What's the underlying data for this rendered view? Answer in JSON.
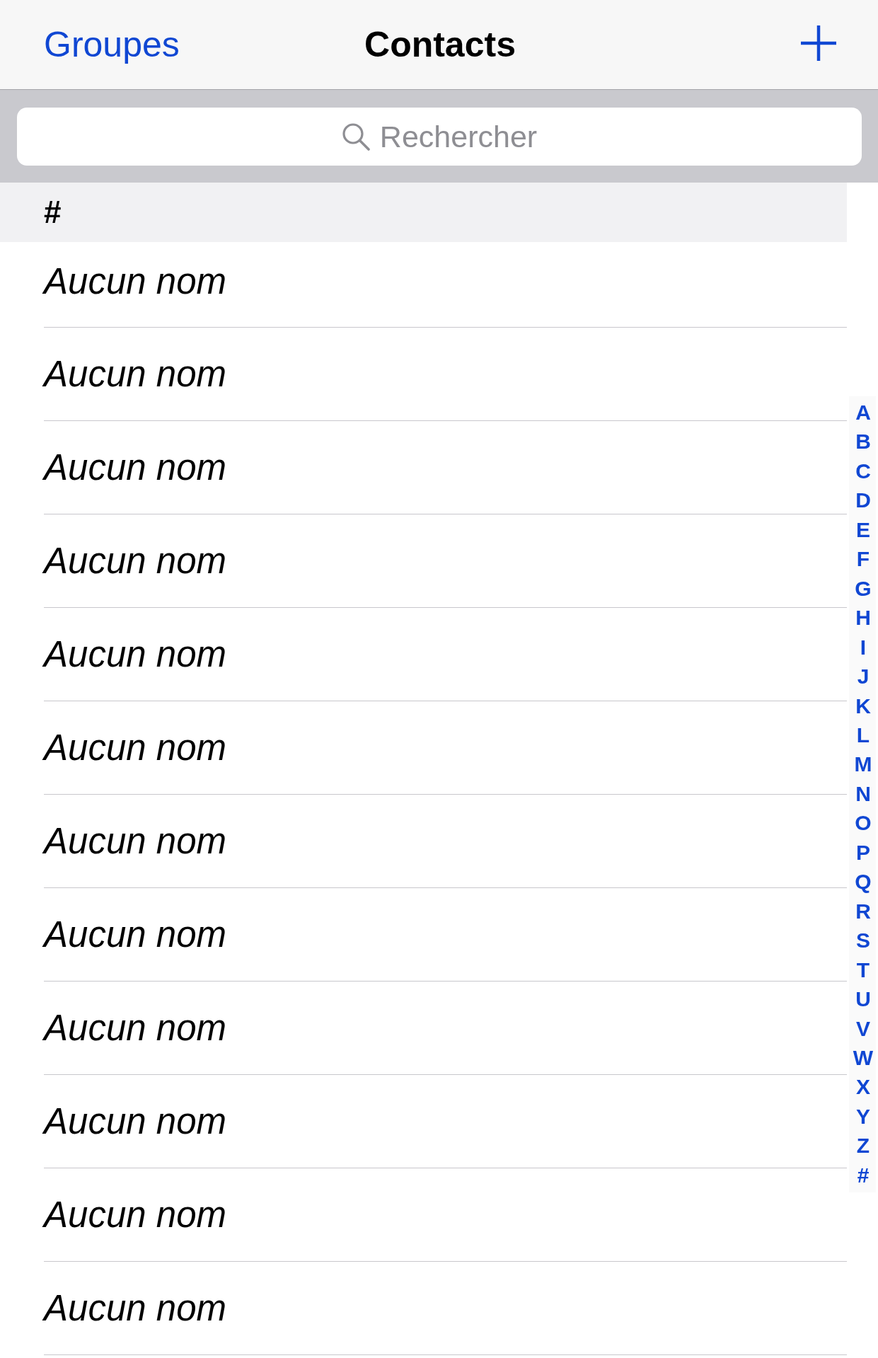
{
  "nav_bar": {
    "left_button": "Groupes",
    "title": "Contacts"
  },
  "search": {
    "placeholder": "Rechercher"
  },
  "sections": [
    {
      "header": "#",
      "rows": [
        {
          "name": "Aucun nom"
        },
        {
          "name": "Aucun nom"
        },
        {
          "name": "Aucun nom"
        },
        {
          "name": "Aucun nom"
        },
        {
          "name": "Aucun nom"
        },
        {
          "name": "Aucun nom"
        },
        {
          "name": "Aucun nom"
        },
        {
          "name": "Aucun nom"
        },
        {
          "name": "Aucun nom"
        },
        {
          "name": "Aucun nom"
        },
        {
          "name": "Aucun nom"
        },
        {
          "name": "Aucun nom"
        }
      ]
    }
  ],
  "section_index": [
    "A",
    "B",
    "C",
    "D",
    "E",
    "F",
    "G",
    "H",
    "I",
    "J",
    "K",
    "L",
    "M",
    "N",
    "O",
    "P",
    "Q",
    "R",
    "S",
    "T",
    "U",
    "V",
    "W",
    "X",
    "Y",
    "Z",
    "#"
  ]
}
